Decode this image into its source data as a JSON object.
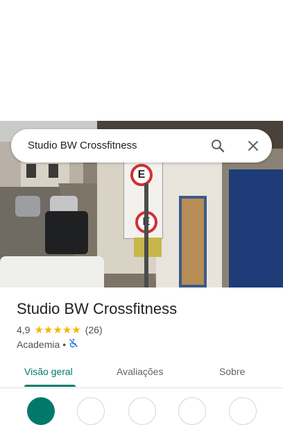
{
  "search": {
    "query": "Studio BW Crossfitness"
  },
  "photo": {
    "sign_letter": "E"
  },
  "place": {
    "name": "Studio BW Crossfitness",
    "rating": "4,9",
    "stars": 5,
    "reviews_count": "(26)",
    "category": "Academia",
    "separator": "•"
  },
  "tabs": [
    {
      "label": "Visão geral",
      "active": true
    },
    {
      "label": "Avaliações",
      "active": false
    },
    {
      "label": "Sobre",
      "active": false
    }
  ],
  "actions": [
    {
      "icon": "directions-icon",
      "primary": true
    },
    {
      "icon": "phone-icon",
      "primary": false
    },
    {
      "icon": "website-icon",
      "primary": false
    },
    {
      "icon": "save-icon",
      "primary": false
    },
    {
      "icon": "share-icon",
      "primary": false
    }
  ],
  "colors": {
    "accent": "#00796b",
    "star": "#f4b400",
    "accessibility_icon": "#1a73e8"
  }
}
